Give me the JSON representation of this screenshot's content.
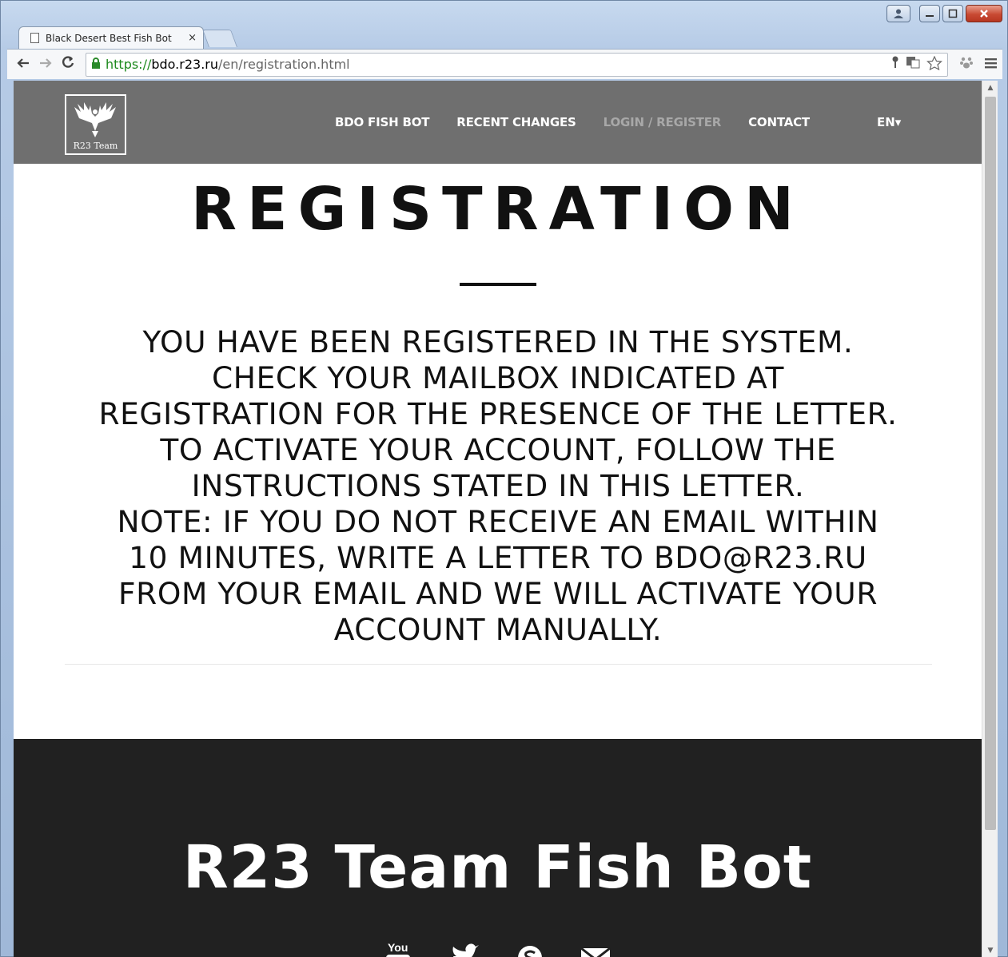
{
  "browser": {
    "tab_title": "Black Desert Best Fish Bot",
    "tab_close": "×",
    "url_scheme": "https://",
    "url_host": "bdo.r23.ru",
    "url_path": "/en/registration.html"
  },
  "site": {
    "logo_text": "R23 Team",
    "nav": [
      "BDO FISH BOT",
      "RECENT CHANGES",
      "LOGIN / REGISTER",
      "CONTACT"
    ],
    "lang": "EN▾"
  },
  "main": {
    "title": "REGISTRATION",
    "message_lines": [
      "YOU HAVE BEEN REGISTERED IN THE SYSTEM.",
      "CHECK YOUR MAILBOX INDICATED AT",
      "REGISTRATION FOR THE PRESENCE OF THE LETTER.",
      "TO ACTIVATE YOUR ACCOUNT, FOLLOW THE",
      "INSTRUCTIONS STATED IN THIS LETTER.",
      "NOTE: IF YOU DO NOT RECEIVE AN EMAIL WITHIN",
      "10 MINUTES, WRITE A LETTER TO BDO@R23.RU",
      "FROM YOUR EMAIL AND WE WILL ACTIVATE YOUR",
      "ACCOUNT MANUALLY."
    ]
  },
  "footer": {
    "title": "R23 Team Fish Bot",
    "youtube_label": "You"
  }
}
